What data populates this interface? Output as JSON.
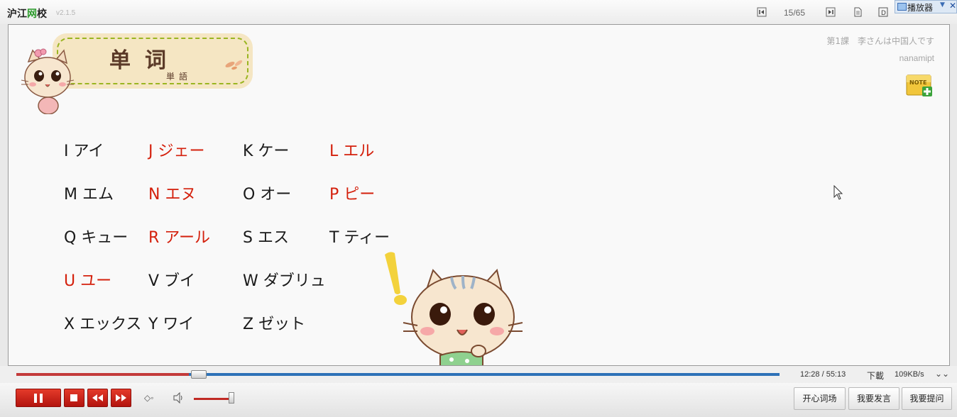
{
  "app": {
    "logo_part1": "沪江",
    "logo_part2": "网",
    "logo_part3": "校",
    "version": "v2.1.5",
    "page_indicator": "15/65",
    "player_menu_label": "播放器"
  },
  "slide": {
    "title": "单词",
    "subtitle": "単語",
    "lesson": "第1課　李さんは中国人です",
    "author": "nanamipt",
    "note_label": "NOTE",
    "accent_red": "#d4200c",
    "words": [
      {
        "text": "I アイ",
        "red": false
      },
      {
        "text": "J ジェー",
        "red": true
      },
      {
        "text": "K ケー",
        "red": false
      },
      {
        "text": "L エル",
        "red": true
      },
      {
        "text": "M エム",
        "red": false
      },
      {
        "text": "N エヌ",
        "red": true
      },
      {
        "text": "O オー",
        "red": false
      },
      {
        "text": "P ピー",
        "red": true
      },
      {
        "text": "Q キュー",
        "red": false
      },
      {
        "text": "R アール",
        "red": true
      },
      {
        "text": "S エス",
        "red": false
      },
      {
        "text": "T ティー",
        "red": false
      },
      {
        "text": "U ユー",
        "red": true
      },
      {
        "text": "V ブイ",
        "red": false
      },
      {
        "text": "W ダブリュ",
        "red": false
      },
      {
        "text": "X エックス",
        "red": false
      },
      {
        "text": "Y ワイ",
        "red": false
      },
      {
        "text": "Z ゼット",
        "red": false
      }
    ]
  },
  "player": {
    "current_time": "12:28",
    "total_time": "55:13",
    "time_display": "12:28 / 55:13",
    "progress_fraction": 0.226,
    "download_label": "下載",
    "speed": "109KB/s",
    "volume_fraction": 0.95,
    "buttons": {
      "vocab": "开心词场",
      "speak": "我要发言",
      "ask": "我要提问"
    }
  }
}
